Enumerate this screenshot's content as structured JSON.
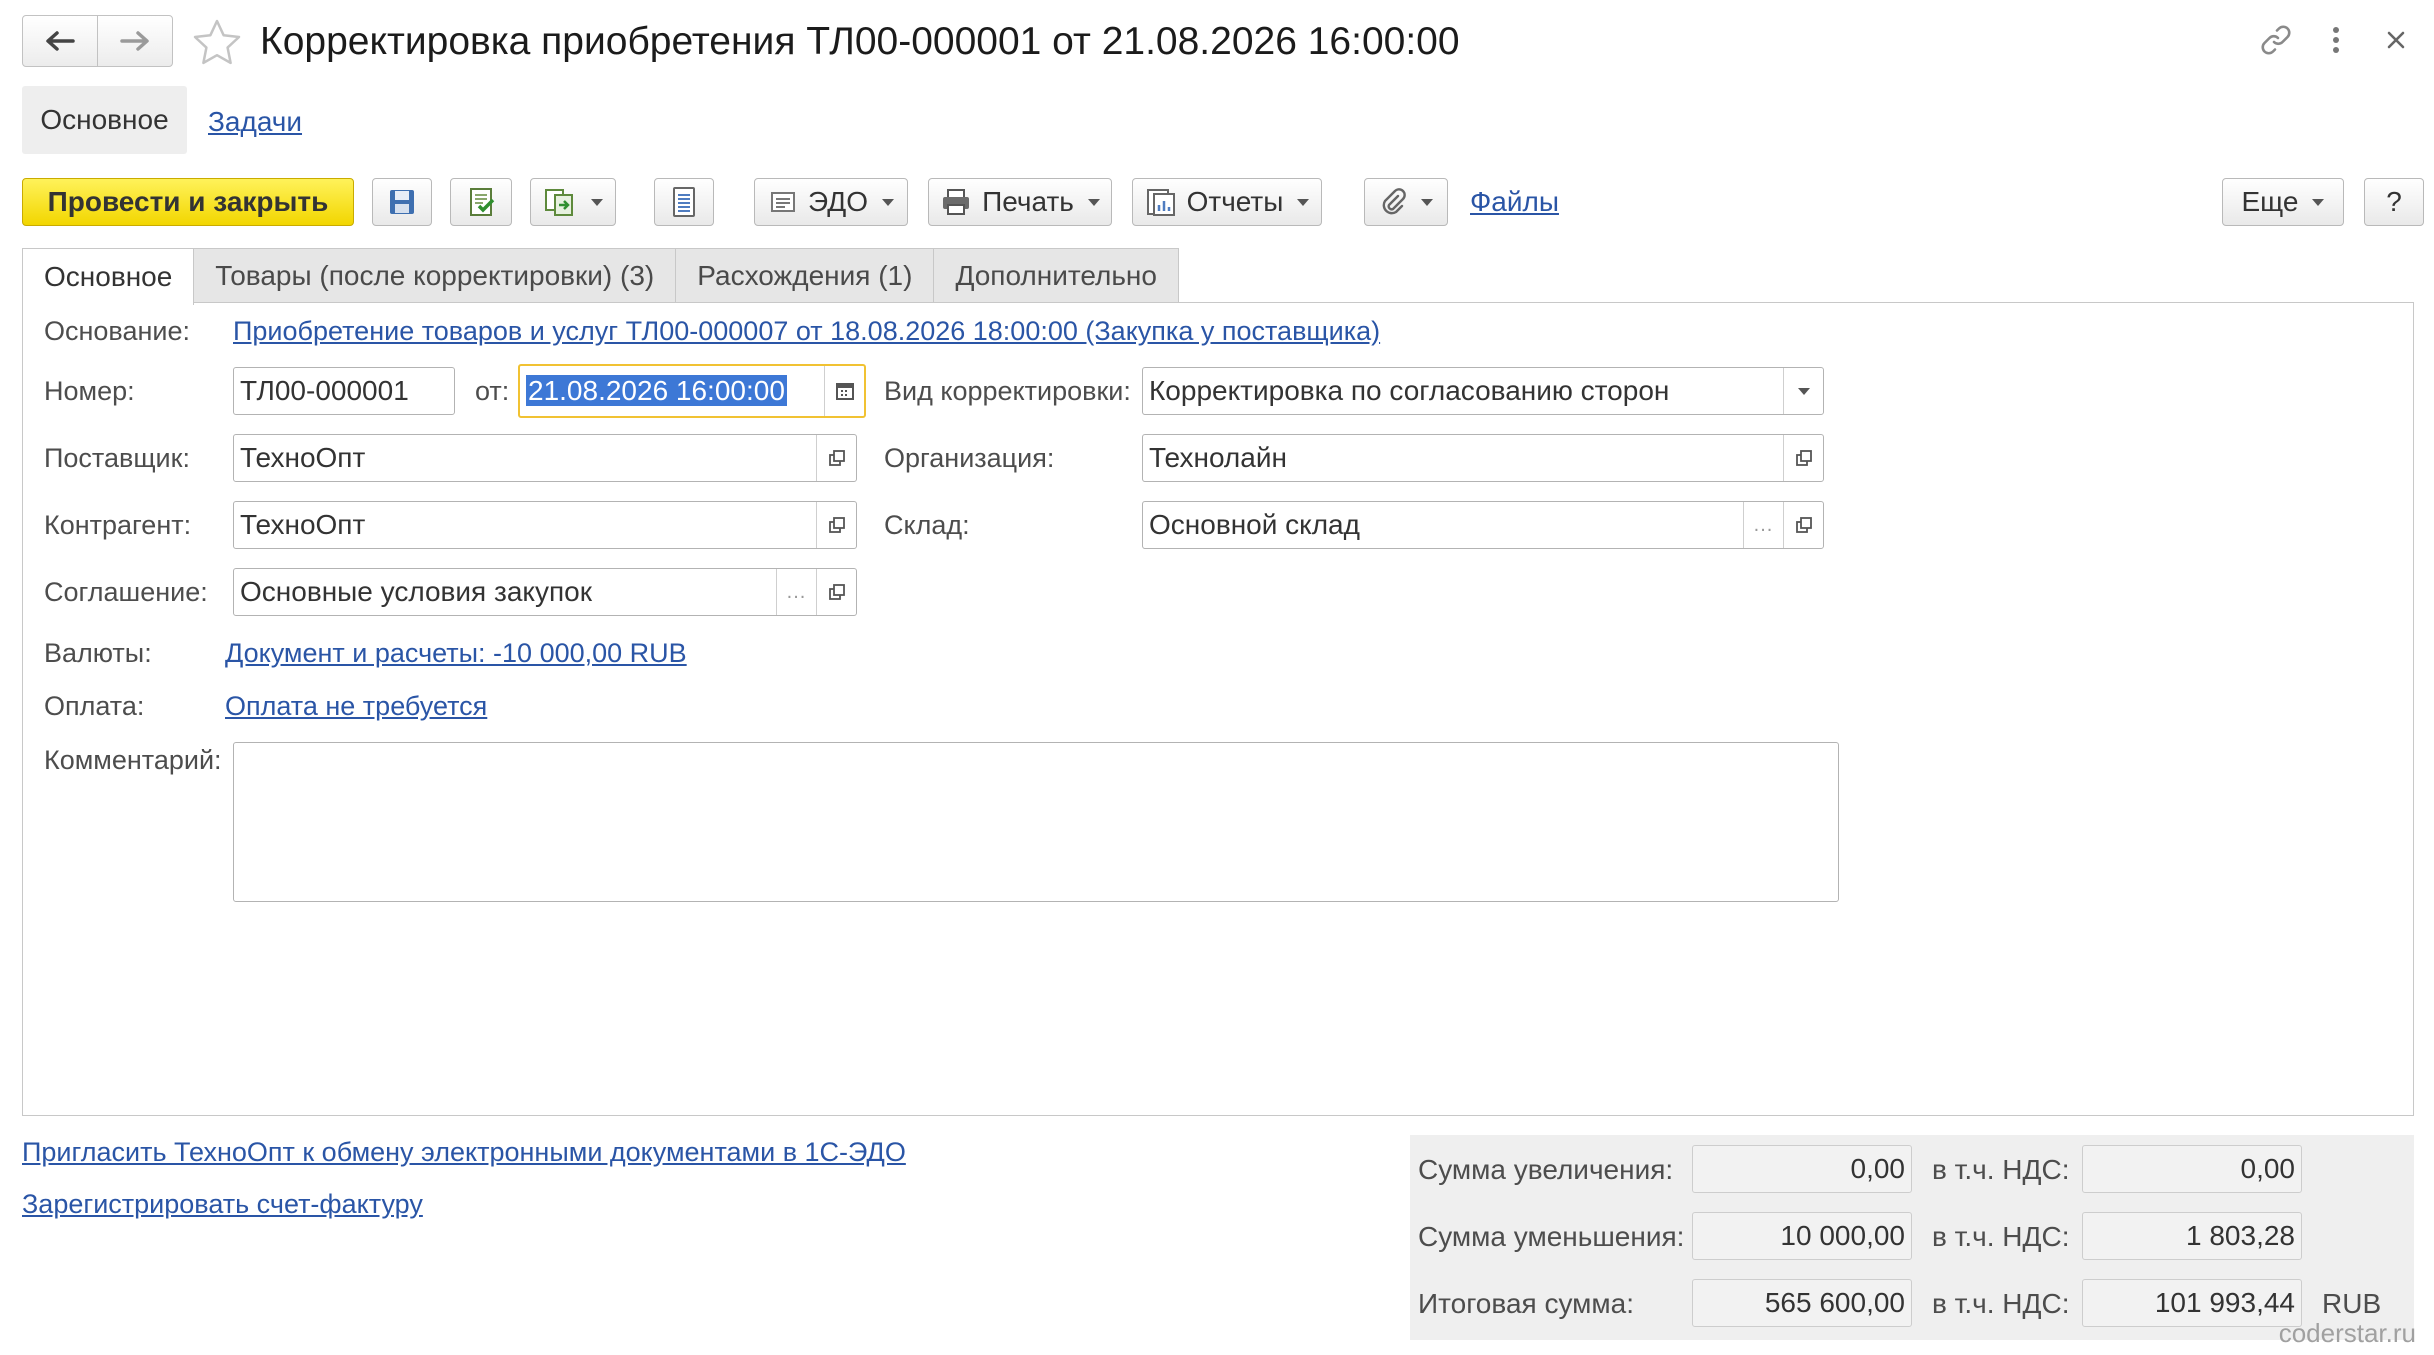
{
  "window": {
    "title": "Корректировка приобретения ТЛ00-000001 от 21.08.2026 16:00:00"
  },
  "sections": {
    "main": "Основное",
    "tasks": "Задачи"
  },
  "toolbar": {
    "post_close": "Провести и закрыть",
    "edo": "ЭДО",
    "print": "Печать",
    "reports": "Отчеты",
    "files": "Файлы",
    "more": "Еще",
    "help": "?"
  },
  "tabs": [
    {
      "label": "Основное"
    },
    {
      "label": "Товары (после корректировки) (3)"
    },
    {
      "label": "Расхождения (1)"
    },
    {
      "label": "Дополнительно"
    }
  ],
  "form": {
    "basis_label": "Основание:",
    "basis_value": "Приобретение товаров и услуг ТЛ00-000007 от 18.08.2026 18:00:00 (Закупка у поставщика)",
    "number_label": "Номер:",
    "number_value": "ТЛ00-000001",
    "from_label": "от:",
    "date_value": "21.08.2026 16:00:00",
    "correction_type_label": "Вид корректировки:",
    "correction_type_value": "Корректировка по согласованию сторон",
    "supplier_label": "Поставщик:",
    "supplier_value": "ТехноОпт",
    "organization_label": "Организация:",
    "organization_value": "Технолайн",
    "counterparty_label": "Контрагент:",
    "counterparty_value": "ТехноОпт",
    "warehouse_label": "Склад:",
    "warehouse_value": "Основной склад",
    "agreement_label": "Соглашение:",
    "agreement_value": "Основные условия закупок",
    "currency_label": "Валюты:",
    "currency_value": "Документ и расчеты: -10 000,00 RUB",
    "payment_label": "Оплата:",
    "payment_value": "Оплата не требуется",
    "comment_label": "Комментарий:",
    "comment_value": ""
  },
  "links": {
    "invite": "Пригласить ТехноОпт к обмену электронными документами в 1С-ЭДО",
    "register_invoice": "Зарегистрировать счет-фактуру"
  },
  "totals": {
    "increase_label": "Сумма увеличения:",
    "increase_value": "0,00",
    "increase_vat_label": "в т.ч. НДС:",
    "increase_vat_value": "0,00",
    "decrease_label": "Сумма уменьшения:",
    "decrease_value": "10 000,00",
    "decrease_vat_label": "в т.ч. НДС:",
    "decrease_vat_value": "1 803,28",
    "total_label": "Итоговая сумма:",
    "total_value": "565 600,00",
    "total_vat_label": "в т.ч. НДС:",
    "total_vat_value": "101 993,44",
    "currency": "RUB"
  },
  "watermark": "coderstar.ru",
  "icons": {
    "back": "arrow-left-icon",
    "forward": "arrow-right-icon",
    "favorite": "star-icon",
    "link": "link-icon",
    "menu": "kebab-icon",
    "close": "close-icon"
  }
}
